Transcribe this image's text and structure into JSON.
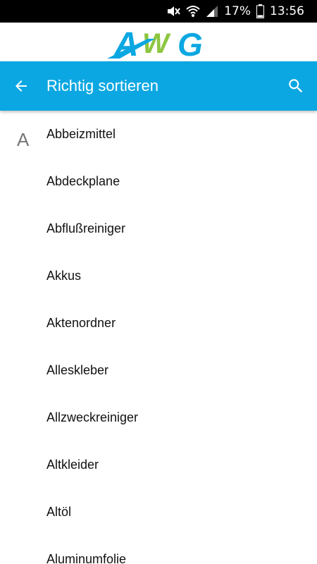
{
  "status_bar": {
    "battery_percent": "17%",
    "time": "13:56",
    "icons": [
      "mute-icon",
      "wifi-icon",
      "signal-icon",
      "battery-icon"
    ]
  },
  "logo": {
    "text": "AWG",
    "colors": {
      "blue": "#0ba7e2",
      "green": "#8cc63f"
    }
  },
  "app_bar": {
    "title": "Richtig sortieren",
    "color": "#0ba7e2"
  },
  "list": {
    "section_letter": "A",
    "items": [
      "Abbeizmittel",
      "Abdeckplane",
      "Abflußreiniger",
      "Akkus",
      "Aktenordner",
      "Alleskleber",
      "Allzweckreiniger",
      "Altkleider",
      "Altöl",
      "Aluminumfolie"
    ]
  }
}
